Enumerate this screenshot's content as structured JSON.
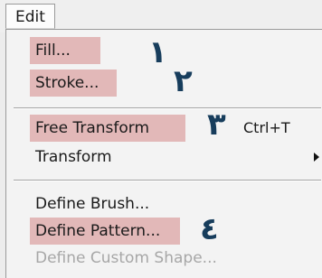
{
  "menu": {
    "title": "Edit",
    "items": [
      {
        "label": "Fill...",
        "enabled": true,
        "highlighted": true,
        "annotation": "١"
      },
      {
        "label": "Stroke...",
        "enabled": true,
        "highlighted": true,
        "annotation": "٢"
      },
      {
        "label": "Free Transform",
        "shortcut": "Ctrl+T",
        "enabled": true,
        "highlighted": true,
        "annotation": "٣"
      },
      {
        "label": "Transform",
        "enabled": true,
        "highlighted": false,
        "has_submenu": true
      },
      {
        "label": "Define Brush...",
        "enabled": true,
        "highlighted": false
      },
      {
        "label": "Define Pattern...",
        "enabled": true,
        "highlighted": true,
        "annotation": "٤"
      },
      {
        "label": "Define Custom Shape...",
        "enabled": false,
        "highlighted": false
      }
    ]
  },
  "colors": {
    "highlight": "#e2b8b8",
    "annotation_number": "#173d5c",
    "disabled_text": "#a7a7a7"
  },
  "icons": [
    "submenu-arrow-icon"
  ]
}
